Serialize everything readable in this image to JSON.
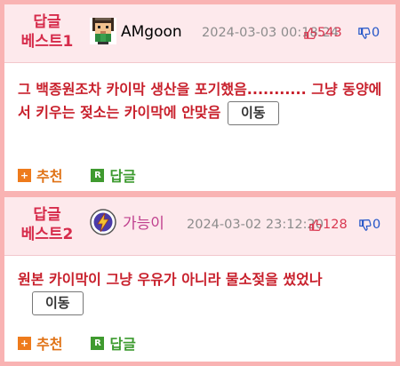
{
  "posts": [
    {
      "badge_line1": "답글",
      "badge_line2": "베스트1",
      "avatar_icon": "pixel-character-avatar-icon",
      "nickname": "AMgoon",
      "nickname_color": "#222222",
      "date": "2024-03-03 00:18:24",
      "upvotes": "543",
      "downvotes": "0",
      "text": "그 백종원조차 카이막 생산을 포기했음........... 그냥 동양에서 키우는 젖소는 카이막에 안맞음",
      "move_label": "이동",
      "recommend_label": "추천",
      "reply_label": "답글"
    },
    {
      "badge_line1": "답글",
      "badge_line2": "베스트2",
      "avatar_icon": "lightning-emblem-avatar-icon",
      "nickname": "가능이",
      "nickname_color": "#c0408e",
      "date": "2024-03-02 23:12:20",
      "upvotes": "128",
      "downvotes": "0",
      "text": "원본 카이막이 그냥 우유가 아니라 물소젖을 썼었나",
      "move_label": "이동",
      "recommend_label": "추천",
      "reply_label": "답글"
    }
  ],
  "colors": {
    "border": "#f9b3b3",
    "header_bg": "#fde9ec",
    "badge": "#d62b4b",
    "body_text": "#c8202c",
    "up": "#d9364f",
    "down": "#2355c8",
    "recommend": "#e07316",
    "reply": "#3b9a2e"
  }
}
